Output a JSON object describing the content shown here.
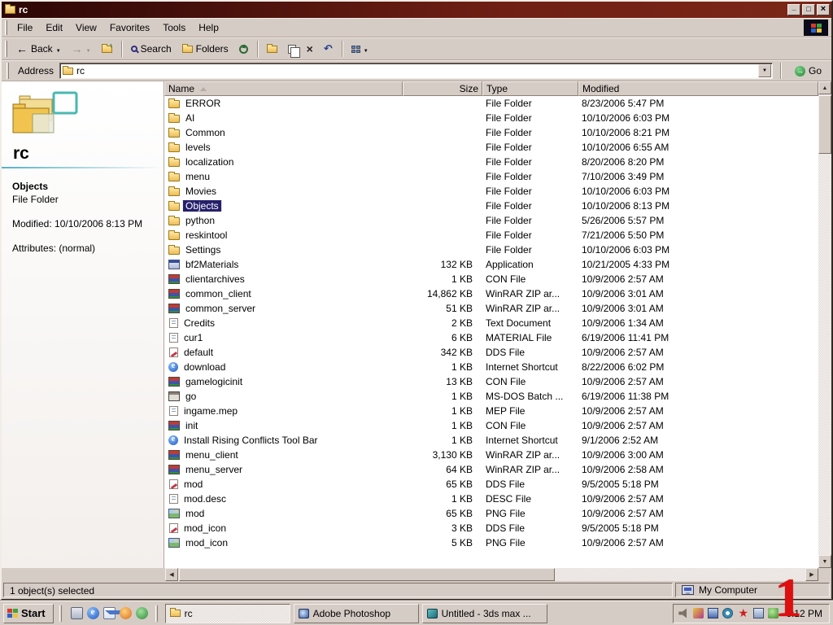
{
  "window": {
    "title": "rc",
    "menu": [
      "File",
      "Edit",
      "View",
      "Favorites",
      "Tools",
      "Help"
    ]
  },
  "toolbar": {
    "back": "Back",
    "search": "Search",
    "folders": "Folders"
  },
  "address": {
    "label": "Address",
    "value": "rc",
    "go": "Go"
  },
  "sidebar": {
    "title": "rc",
    "item_name": "Objects",
    "item_type": "File Folder",
    "modified": "Modified: 10/10/2006 8:13 PM",
    "attributes": "Attributes: (normal)"
  },
  "list": {
    "columns": [
      "Name",
      "Size",
      "Type",
      "Modified"
    ],
    "sort_column": "Name",
    "rows": [
      {
        "name": "ERROR",
        "size": "",
        "type": "File Folder",
        "modified": "8/23/2006 5:47 PM",
        "icon": "folder"
      },
      {
        "name": "AI",
        "size": "",
        "type": "File Folder",
        "modified": "10/10/2006 6:03 PM",
        "icon": "folder"
      },
      {
        "name": "Common",
        "size": "",
        "type": "File Folder",
        "modified": "10/10/2006 8:21 PM",
        "icon": "folder"
      },
      {
        "name": "levels",
        "size": "",
        "type": "File Folder",
        "modified": "10/10/2006 6:55 AM",
        "icon": "folder"
      },
      {
        "name": "localization",
        "size": "",
        "type": "File Folder",
        "modified": "8/20/2006 8:20 PM",
        "icon": "folder"
      },
      {
        "name": "menu",
        "size": "",
        "type": "File Folder",
        "modified": "7/10/2006 3:49 PM",
        "icon": "folder"
      },
      {
        "name": "Movies",
        "size": "",
        "type": "File Folder",
        "modified": "10/10/2006 6:03 PM",
        "icon": "folder"
      },
      {
        "name": "Objects",
        "size": "",
        "type": "File Folder",
        "modified": "10/10/2006 8:13 PM",
        "icon": "folder",
        "selected": true
      },
      {
        "name": "python",
        "size": "",
        "type": "File Folder",
        "modified": "5/26/2006 5:57 PM",
        "icon": "folder"
      },
      {
        "name": "reskintool",
        "size": "",
        "type": "File Folder",
        "modified": "7/21/2006 5:50 PM",
        "icon": "folder"
      },
      {
        "name": "Settings",
        "size": "",
        "type": "File Folder",
        "modified": "10/10/2006 6:03 PM",
        "icon": "folder"
      },
      {
        "name": "bf2Materials",
        "size": "132 KB",
        "type": "Application",
        "modified": "10/21/2005 4:33 PM",
        "icon": "app"
      },
      {
        "name": "clientarchives",
        "size": "1 KB",
        "type": "CON File",
        "modified": "10/9/2006 2:57 AM",
        "icon": "books"
      },
      {
        "name": "common_client",
        "size": "14,862 KB",
        "type": "WinRAR ZIP ar...",
        "modified": "10/9/2006 3:01 AM",
        "icon": "books"
      },
      {
        "name": "common_server",
        "size": "51 KB",
        "type": "WinRAR ZIP ar...",
        "modified": "10/9/2006 3:01 AM",
        "icon": "books"
      },
      {
        "name": "Credits",
        "size": "2 KB",
        "type": "Text Document",
        "modified": "10/9/2006 1:34 AM",
        "icon": "txt"
      },
      {
        "name": "cur1",
        "size": "6 KB",
        "type": "MATERIAL File",
        "modified": "6/19/2006 11:41 PM",
        "icon": "doc"
      },
      {
        "name": "default",
        "size": "342 KB",
        "type": "DDS File",
        "modified": "10/9/2006 2:57 AM",
        "icon": "dds"
      },
      {
        "name": "download",
        "size": "1 KB",
        "type": "Internet Shortcut",
        "modified": "8/22/2006 6:02 PM",
        "icon": "ie"
      },
      {
        "name": "gamelogicinit",
        "size": "13 KB",
        "type": "CON File",
        "modified": "10/9/2006 2:57 AM",
        "icon": "books"
      },
      {
        "name": "go",
        "size": "1 KB",
        "type": "MS-DOS Batch ...",
        "modified": "6/19/2006 11:38 PM",
        "icon": "bat"
      },
      {
        "name": "ingame.mep",
        "size": "1 KB",
        "type": "MEP File",
        "modified": "10/9/2006 2:57 AM",
        "icon": "doc"
      },
      {
        "name": "init",
        "size": "1 KB",
        "type": "CON File",
        "modified": "10/9/2006 2:57 AM",
        "icon": "books"
      },
      {
        "name": "Install Rising Conflicts Tool Bar",
        "size": "1 KB",
        "type": "Internet Shortcut",
        "modified": "9/1/2006 2:52 AM",
        "icon": "ie"
      },
      {
        "name": "menu_client",
        "size": "3,130 KB",
        "type": "WinRAR ZIP ar...",
        "modified": "10/9/2006 3:00 AM",
        "icon": "books"
      },
      {
        "name": "menu_server",
        "size": "64 KB",
        "type": "WinRAR ZIP ar...",
        "modified": "10/9/2006 2:58 AM",
        "icon": "books"
      },
      {
        "name": "mod",
        "size": "65 KB",
        "type": "DDS File",
        "modified": "9/5/2005 5:18 PM",
        "icon": "dds"
      },
      {
        "name": "mod.desc",
        "size": "1 KB",
        "type": "DESC File",
        "modified": "10/9/2006 2:57 AM",
        "icon": "doc"
      },
      {
        "name": "mod",
        "size": "65 KB",
        "type": "PNG File",
        "modified": "10/9/2006 2:57 AM",
        "icon": "png"
      },
      {
        "name": "mod_icon",
        "size": "3 KB",
        "type": "DDS File",
        "modified": "9/5/2005 5:18 PM",
        "icon": "dds"
      },
      {
        "name": "mod_icon",
        "size": "5 KB",
        "type": "PNG File",
        "modified": "10/9/2006 2:57 AM",
        "icon": "png"
      }
    ]
  },
  "statusbar": {
    "selection": "1 object(s) selected",
    "zone": "My Computer"
  },
  "taskbar": {
    "start": "Start",
    "quicklaunch": [
      "show-desktop",
      "internet-explorer",
      "outlook-express",
      "media-player",
      "msn-messenger"
    ],
    "tasks": [
      {
        "label": "rc",
        "icon": "folder",
        "active": true
      },
      {
        "label": "Adobe Photoshop",
        "icon": "photoshop",
        "active": false
      },
      {
        "label": "Untitled - 3ds max ...",
        "icon": "max",
        "active": false
      }
    ],
    "tray": [
      "volume",
      "graphics",
      "display",
      "scheduler",
      "antivirus",
      "network",
      "update"
    ],
    "clock": "6:12 PM"
  },
  "overlay": {
    "digit": "1",
    "color": "#dd0f0f"
  }
}
